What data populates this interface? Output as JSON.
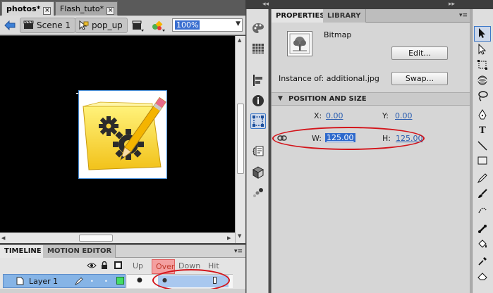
{
  "document_tabs": [
    {
      "label": "photos*",
      "active": true
    },
    {
      "label": "Flash_tuto*",
      "active": false
    }
  ],
  "close_glyph": "×",
  "editbar": {
    "back_icon": "arrow-left-icon",
    "scene_label": "Scene 1",
    "symbol_label": "pop_up",
    "zoom_value": "100%"
  },
  "timeline": {
    "tabs": [
      "TIMELINE",
      "MOTION EDITOR"
    ],
    "frame_labels": [
      "Up",
      "Over",
      "Down",
      "Hit"
    ],
    "layer_name": "Layer 1"
  },
  "properties": {
    "tabs": [
      "PROPERTIES",
      "LIBRARY"
    ],
    "object_type": "Bitmap",
    "edit_button": "Edit...",
    "instance_label": "Instance of:",
    "instance_value": "additional.jpg",
    "swap_button": "Swap...",
    "section_title": "POSITION AND SIZE",
    "x_label": "X:",
    "x_value": "0.00",
    "y_label": "Y:",
    "y_value": "0.00",
    "w_label": "W:",
    "w_value": "125.00",
    "h_label": "H:",
    "h_value": "125.00"
  },
  "colors": {
    "stage": "#000000",
    "highlight_ellipse": "#d3141a",
    "selection_blue": "#2f6acc",
    "over_frame": "#f4a0a0",
    "layer_row": "#86b4e6"
  }
}
